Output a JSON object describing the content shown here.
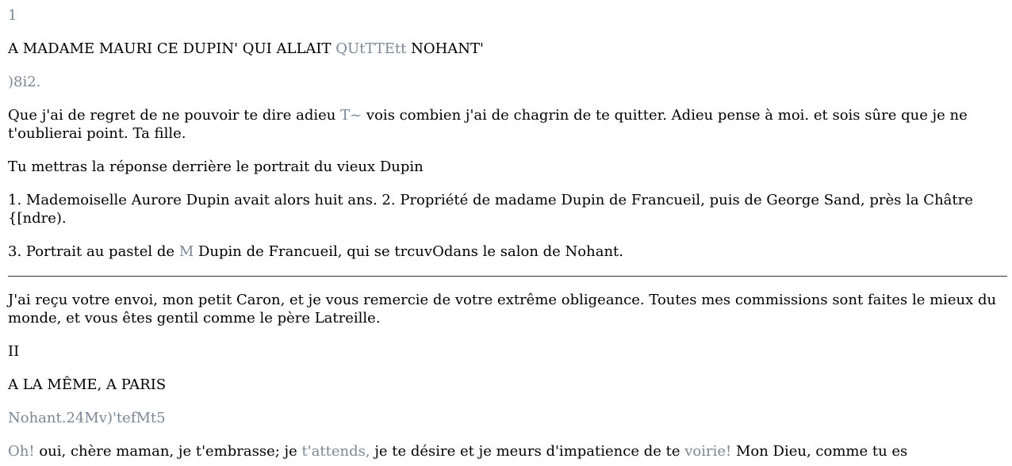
{
  "document": {
    "page_number": "1",
    "heading_1": {
      "a": "A MADAME MAURI CE DUPIN' QUI ALLAIT ",
      "b": "QUtTTEtt",
      "c": " NOHANT'"
    },
    "date_1": ")8i2.",
    "letter_1": {
      "a": "Que j'ai de regret de ne pouvoir te dire adieu ",
      "b": "T~",
      "c": " vois combien j'ai de chagrin de te quitter. Adieu pense à moi. et sois sûre que je ne t'oublierai point. Ta fille."
    },
    "postscript_1": "Tu mettras la réponse derrière le portrait du vieux Dupin",
    "footnote_1_2": "1. Mademoiselle Aurore Dupin avait alors huit ans. 2. Propriété de madame Dupin de Francueil, puis de George Sand, près la Châtre {[ndre).",
    "footnote_3": {
      "a": "3. Portrait au pastel de ",
      "b": "M",
      "c": " Dupin de Francueil, qui se trcuvOdans le salon de Nohant."
    },
    "letter_1b": "J'ai reçu votre envoi, mon petit Caron, et je vous remercie de votre extrême obligeance. Toutes mes commissions sont faites le mieux du monde, et vous êtes gentil comme le père Latreille.",
    "numeral_2": "II",
    "heading_2": "A LA MÊME, A PARIS",
    "date_2": "Nohant.24Mv)'tefMt5",
    "letter_2": {
      "a": "Oh!",
      "b": " oui, chère maman, je t'embrasse; je ",
      "c": "t'attends,",
      "d": " je te désire et je meurs d'impatience de te ",
      "e": "voirie!",
      "f": " Mon Dieu, comme tu es"
    },
    "colors": {
      "text": "#000000",
      "dim_text": "#7a8795",
      "rule": "#333333"
    }
  }
}
